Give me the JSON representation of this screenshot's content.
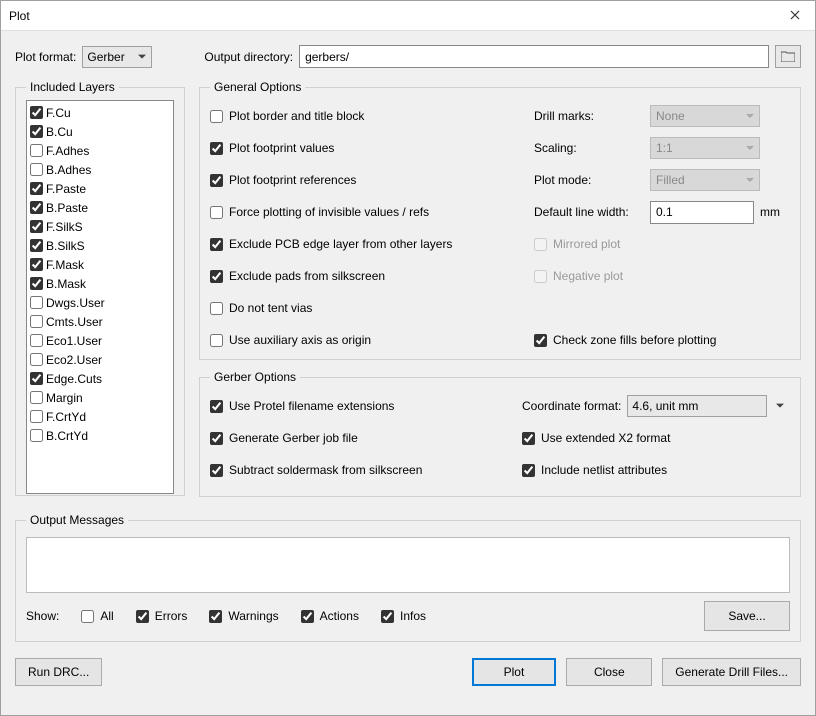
{
  "window": {
    "title": "Plot"
  },
  "top": {
    "plot_format_label": "Plot format:",
    "plot_format_value": "Gerber",
    "output_dir_label": "Output directory:",
    "output_dir_value": "gerbers/"
  },
  "layers": {
    "legend": "Included Layers",
    "items": [
      {
        "name": "F.Cu",
        "checked": true
      },
      {
        "name": "B.Cu",
        "checked": true
      },
      {
        "name": "F.Adhes",
        "checked": false
      },
      {
        "name": "B.Adhes",
        "checked": false
      },
      {
        "name": "F.Paste",
        "checked": true
      },
      {
        "name": "B.Paste",
        "checked": true
      },
      {
        "name": "F.SilkS",
        "checked": true
      },
      {
        "name": "B.SilkS",
        "checked": true
      },
      {
        "name": "F.Mask",
        "checked": true
      },
      {
        "name": "B.Mask",
        "checked": true
      },
      {
        "name": "Dwgs.User",
        "checked": false
      },
      {
        "name": "Cmts.User",
        "checked": false
      },
      {
        "name": "Eco1.User",
        "checked": false
      },
      {
        "name": "Eco2.User",
        "checked": false
      },
      {
        "name": "Edge.Cuts",
        "checked": true
      },
      {
        "name": "Margin",
        "checked": false
      },
      {
        "name": "F.CrtYd",
        "checked": false
      },
      {
        "name": "B.CrtYd",
        "checked": false
      }
    ]
  },
  "general": {
    "legend": "General Options",
    "left_checks": [
      {
        "id": "border",
        "label": "Plot border and title block",
        "checked": false
      },
      {
        "id": "footprint-values",
        "label": "Plot footprint values",
        "checked": true
      },
      {
        "id": "footprint-refs",
        "label": "Plot footprint references",
        "checked": true
      },
      {
        "id": "force-invisible",
        "label": "Force plotting of invisible values / refs",
        "checked": false
      },
      {
        "id": "exclude-edge",
        "label": "Exclude PCB edge layer from other layers",
        "checked": true
      },
      {
        "id": "exclude-pads",
        "label": "Exclude pads from silkscreen",
        "checked": true
      },
      {
        "id": "no-tent",
        "label": "Do not tent vias",
        "checked": false
      },
      {
        "id": "aux-axis",
        "label": "Use auxiliary axis as origin",
        "checked": false
      }
    ],
    "drill_marks_label": "Drill marks:",
    "drill_marks_value": "None",
    "scaling_label": "Scaling:",
    "scaling_value": "1:1",
    "plot_mode_label": "Plot mode:",
    "plot_mode_value": "Filled",
    "default_lw_label": "Default line width:",
    "default_lw_value": "0.1",
    "default_lw_unit": "mm",
    "mirrored_label": "Mirrored plot",
    "negative_label": "Negative plot",
    "check_zone_label": "Check zone fills before plotting",
    "check_zone_checked": true
  },
  "gerber": {
    "legend": "Gerber Options",
    "left_checks": [
      {
        "id": "protel",
        "label": "Use Protel filename extensions",
        "checked": true
      },
      {
        "id": "jobfile",
        "label": "Generate Gerber job file",
        "checked": true
      },
      {
        "id": "subtract",
        "label": "Subtract soldermask from silkscreen",
        "checked": true
      }
    ],
    "coord_label": "Coordinate format:",
    "coord_value": "4.6, unit mm",
    "x2_label": "Use extended X2 format",
    "x2_checked": true,
    "netlist_label": "Include netlist attributes",
    "netlist_checked": true
  },
  "output": {
    "legend": "Output Messages",
    "show_label": "Show:",
    "all": "All",
    "errors": "Errors",
    "warnings": "Warnings",
    "actions": "Actions",
    "infos": "Infos",
    "save": "Save..."
  },
  "buttons": {
    "drc": "Run DRC...",
    "plot": "Plot",
    "close": "Close",
    "drill": "Generate Drill Files..."
  }
}
